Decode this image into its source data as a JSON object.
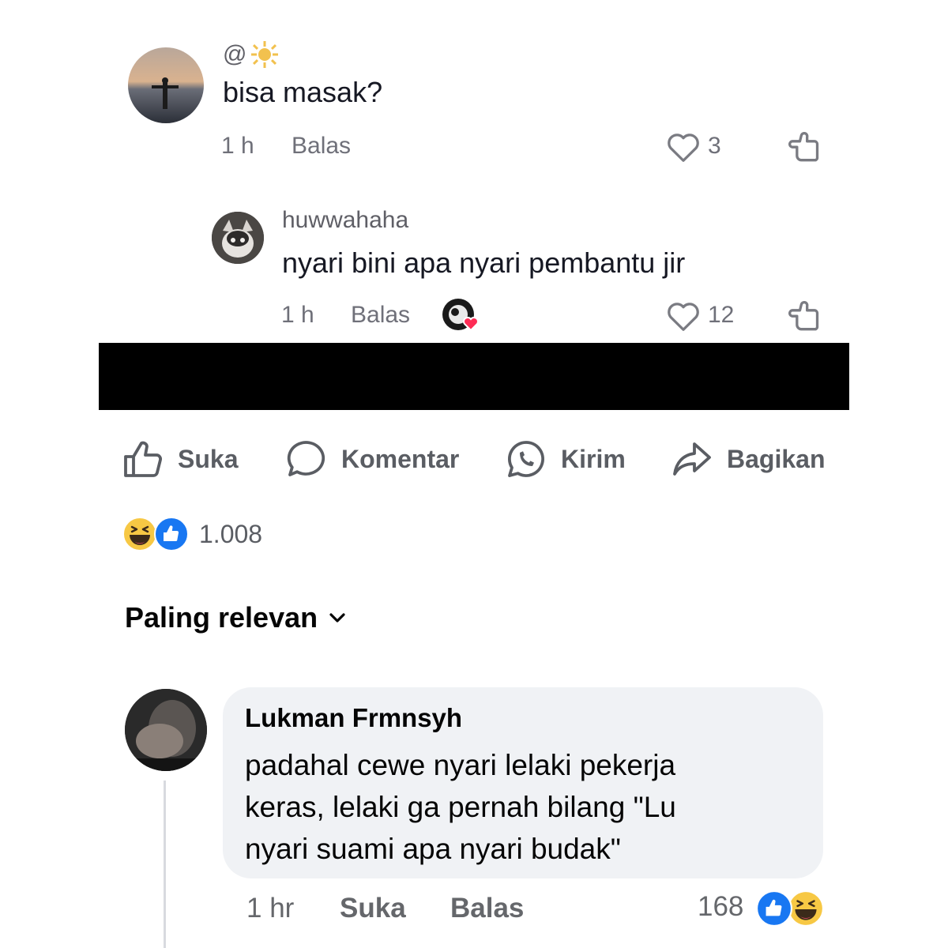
{
  "comment1": {
    "username": "@",
    "text": "bisa masak?",
    "time": "1 h",
    "reply_label": "Balas",
    "likes": "3"
  },
  "reply1": {
    "username": "huwwahaha",
    "text": "nyari bini apa nyari pembantu jir",
    "time": "1 h",
    "reply_label": "Balas",
    "likes": "12"
  },
  "actions": {
    "like": "Suka",
    "comment": "Komentar",
    "send": "Kirim",
    "share": "Bagikan"
  },
  "reactions": {
    "count": "1.008"
  },
  "sort": {
    "label": "Paling relevan"
  },
  "fb_comment": {
    "author": "Lukman Frmnsyh",
    "lines": [
      "padahal cewe nyari lelaki pekerja",
      "keras, lelaki ga pernah bilang \"Lu",
      "nyari suami apa nyari budak\""
    ],
    "time": "1 hr",
    "like_label": "Suka",
    "reply_label": "Balas",
    "reaction_count": "168"
  },
  "colors": {
    "fb_blue": "#1877f2",
    "emoji_yellow": "#f7c844",
    "bubble_bg": "#f0f2f5",
    "redaction": "#000000"
  }
}
